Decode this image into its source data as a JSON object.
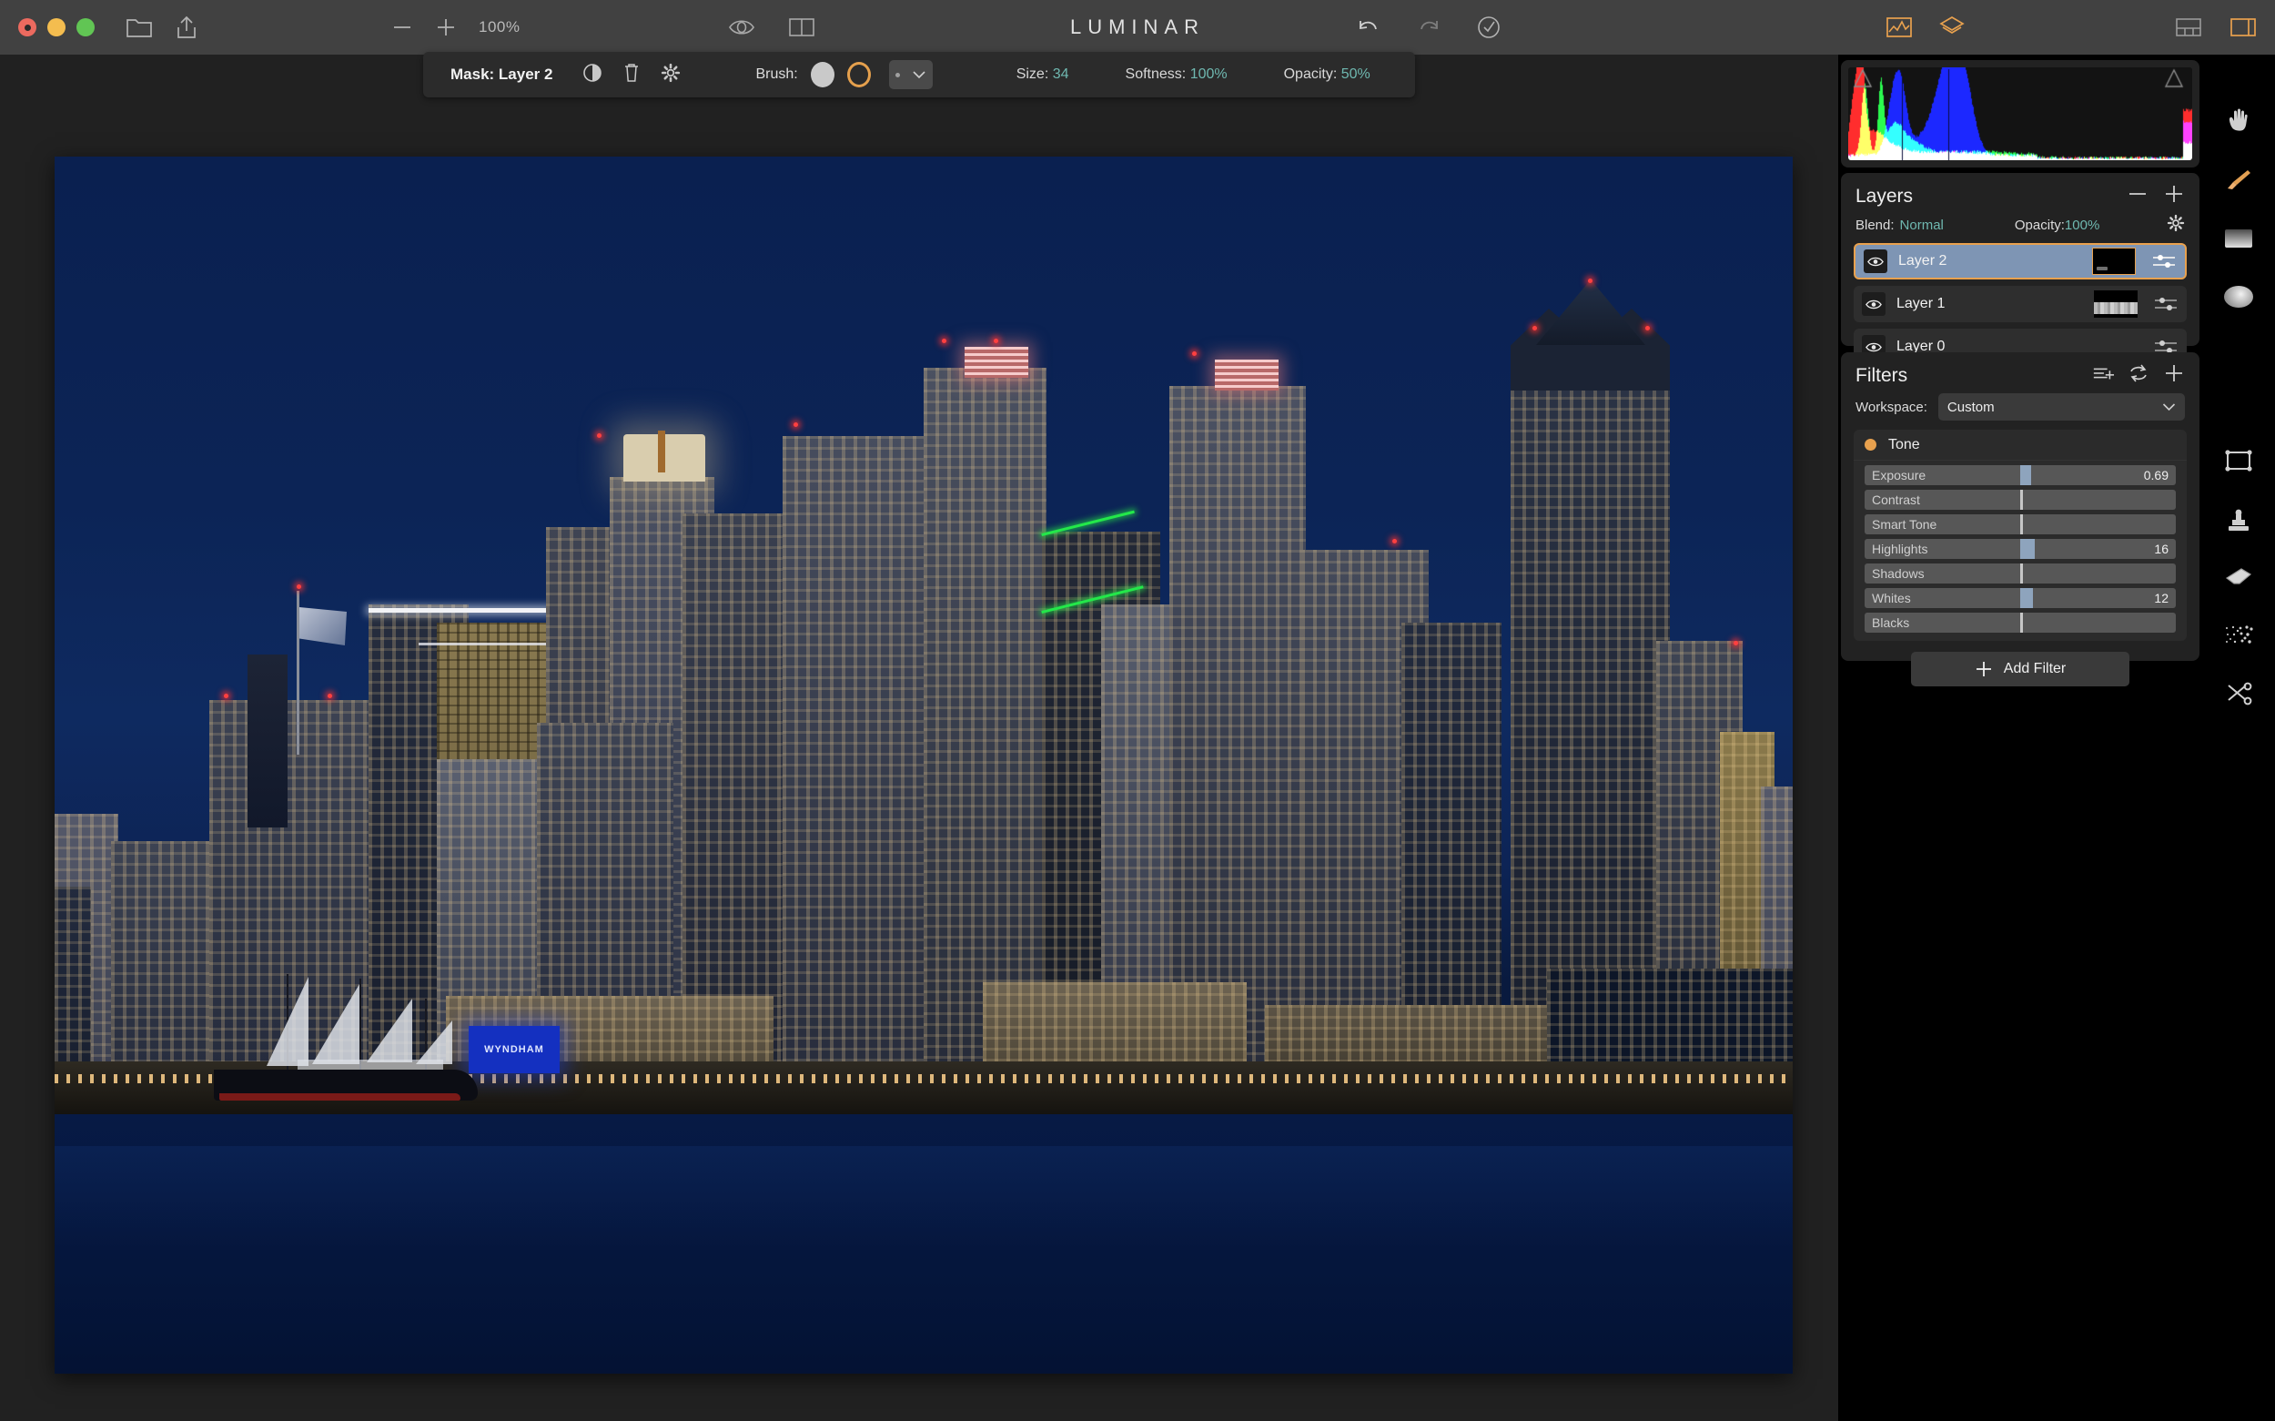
{
  "titlebar": {
    "app_title": "LUMINAR",
    "zoom_level": "100%",
    "traffic_lights": [
      "close",
      "minimize",
      "maximize"
    ],
    "icons": {
      "folder": "folder-icon",
      "share": "share-icon",
      "zoom_out": "minus-icon",
      "zoom_in": "plus-icon",
      "preview_eye": "eye-icon",
      "compare_split": "compare-view-icon",
      "undo": "undo-icon",
      "redo": "redo-icon",
      "history": "history-clock-icon",
      "histogram_toggle": "histogram-icon",
      "layers_toggle": "layers-icon",
      "filmstrip_toggle": "filmstrip-icon",
      "right_panel_toggle": "side-panel-icon"
    }
  },
  "mask_toolbar": {
    "title": "Mask: Layer 2",
    "icons": {
      "invert": "mask-invert-icon",
      "delete": "trash-icon",
      "settings": "gear-icon"
    },
    "brush_label": "Brush:",
    "brush_modes": [
      "paint-solid",
      "paint-erase"
    ],
    "preset_label": "brush-preset-dropdown",
    "size_label": "Size:",
    "size_value": "34",
    "softness_label": "Softness:",
    "softness_value": "100%",
    "opacity_label": "Opacity:",
    "opacity_value": "50%"
  },
  "photo": {
    "description": "San Diego skyline at night over the bay with the tall ship Star of India moored at the waterfront",
    "sign_text": "WYNDHAM"
  },
  "histogram": {
    "name": "rgb-histogram",
    "shadow_clip_marker": "shadow-clipping-triangle",
    "highlight_clip_marker": "highlight-clipping-triangle"
  },
  "layers": {
    "title": "Layers",
    "remove_label": "remove-layer",
    "add_label": "add-layer",
    "blend_label": "Blend:",
    "blend_value": "Normal",
    "opacity_label": "Opacity:",
    "opacity_value": "100%",
    "items": [
      {
        "name": "Layer 2",
        "visible": true,
        "selected": true,
        "thumb": "mask"
      },
      {
        "name": "Layer 1",
        "visible": true,
        "selected": false,
        "thumb": "image"
      },
      {
        "name": "Layer 0",
        "visible": true,
        "selected": false,
        "thumb": "none"
      }
    ]
  },
  "filters": {
    "title": "Filters",
    "workspace_label": "Workspace:",
    "workspace_value": "Custom",
    "head_icons": {
      "save": "save-workspace-icon",
      "reset": "reset-icon",
      "add": "plus-icon"
    },
    "group": {
      "name": "Tone",
      "enabled_color": "#e8a14e",
      "sliders": [
        {
          "name": "Exposure",
          "value": "0.69",
          "pct": 52,
          "has_value": true
        },
        {
          "name": "Contrast",
          "value": "",
          "pct": 50,
          "has_value": false
        },
        {
          "name": "Smart Tone",
          "value": "",
          "pct": 50,
          "has_value": false
        },
        {
          "name": "Highlights",
          "value": "16",
          "pct": 53,
          "has_value": true
        },
        {
          "name": "Shadows",
          "value": "",
          "pct": 50,
          "has_value": false
        },
        {
          "name": "Whites",
          "value": "12",
          "pct": 52.5,
          "has_value": true
        },
        {
          "name": "Blacks",
          "value": "",
          "pct": 50,
          "has_value": false
        }
      ]
    },
    "add_filter_label": "Add Filter"
  },
  "tool_rail": {
    "tools": [
      {
        "name": "hand-tool",
        "active": false
      },
      {
        "name": "brush-tool",
        "active": true
      },
      {
        "name": "gradient-tool",
        "active": false
      },
      {
        "name": "radial-mask-tool",
        "active": false
      },
      {
        "name": "crop-tool",
        "active": false
      },
      {
        "name": "clone-stamp-tool",
        "active": false
      },
      {
        "name": "erase-tool",
        "active": false
      },
      {
        "name": "denoise-tool",
        "active": false
      },
      {
        "name": "cut-tool",
        "active": false
      }
    ]
  },
  "colors": {
    "accent": "#e8a14e",
    "teal_value": "#6fb8b0",
    "selected_layer": "#7e95b4",
    "panel_bg": "#222222",
    "titlebar_bg": "#414141"
  }
}
